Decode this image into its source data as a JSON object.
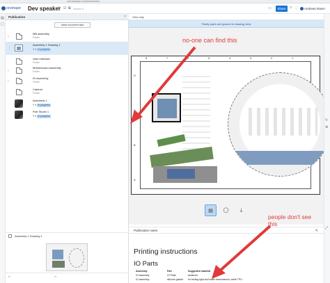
{
  "browser": {
    "url": "cad.onshape.com/documents/..."
  },
  "header": {
    "logo": "onshape",
    "title": "Dev speaker",
    "subtitle": "Sonos II",
    "share_label": "Share",
    "user_name": "Andreas Rasm"
  },
  "panel": {
    "title": "Publication",
    "insert_label": "Insert document tabs",
    "items": [
      {
        "name": "MB assembly",
        "sub": "Folder",
        "type": "folder"
      },
      {
        "name": "Assembly 1 Drawing 1",
        "sub": "In progress",
        "type": "drawing",
        "selected": true
      },
      {
        "name": "User interface",
        "sub": "Folder",
        "type": "folder"
      },
      {
        "name": "Motherboard assembly",
        "sub": "Folder",
        "type": "folder"
      },
      {
        "name": "IO Assembly",
        "sub": "Folder",
        "type": "folder"
      },
      {
        "name": "Cabinet",
        "sub": "Folder",
        "type": "folder"
      },
      {
        "name": "Assembly 1",
        "sub": "In progress",
        "type": "part"
      },
      {
        "name": "Part Studio 1",
        "sub": "In progress",
        "type": "part"
      }
    ],
    "thumb_title": "Assembly 1 Drawing 1"
  },
  "viewer": {
    "mode": "View only",
    "banner": "Faulty parts are ignored in drawing view",
    "zones_top": [
      "8",
      "7",
      "6",
      "5",
      "4",
      "3",
      "2",
      "1"
    ],
    "zones_side": [
      "D",
      "C",
      "B",
      "A"
    ]
  },
  "annotations": {
    "note1": "no-one can find this",
    "note2_line1": "people don't see",
    "note2_line2": "this"
  },
  "notes": {
    "section_title": "Publication notes",
    "heading": "Printing instructions",
    "subheading": "IO Parts",
    "columns": [
      "Assembly",
      "Part",
      "Suggested material"
    ],
    "rows": [
      [
        "IO assembly",
        "IO Plate",
        "whatever"
      ],
      [
        "IO assembly",
        "silicone gasket",
        "for testing light and water transmission, white TPU"
      ]
    ]
  },
  "colors": {
    "accent": "#1976d2",
    "annotation": "#e03a3a",
    "banner": "#d7e8f7"
  }
}
